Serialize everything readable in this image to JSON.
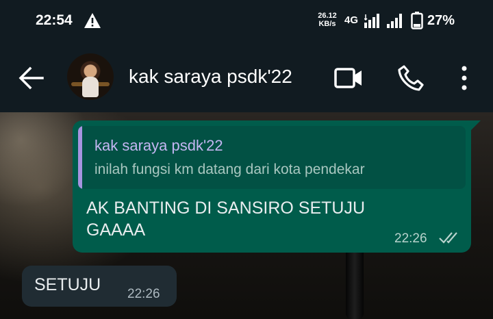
{
  "status_bar": {
    "time": "22:54",
    "speed_value": "26.12",
    "speed_unit": "KB/s",
    "network": "4G",
    "battery_percent": "27%",
    "icons": [
      "warning-icon",
      "signal-icon",
      "signal-icon",
      "battery-icon"
    ]
  },
  "header": {
    "contact_name": "kak saraya psdk'22",
    "icons": [
      "back-arrow-icon",
      "video-call-icon",
      "phone-icon",
      "more-vertical-icon"
    ]
  },
  "messages": [
    {
      "direction": "outgoing",
      "quote": {
        "author": "kak saraya psdk'22",
        "text": "inilah fungsi km datang dari kota pendekar"
      },
      "text": "AK BANTING DI SANSIRO SETUJU GAAAA",
      "time": "22:26",
      "status": "read-ticks-icon"
    },
    {
      "direction": "incoming",
      "text": "SETUJU",
      "time": "22:26"
    }
  ],
  "colors": {
    "header_bg": "#111b21",
    "outgoing_bubble": "#005c4b",
    "incoming_bubble": "#202c33",
    "quote_accent": "#a794e0"
  }
}
